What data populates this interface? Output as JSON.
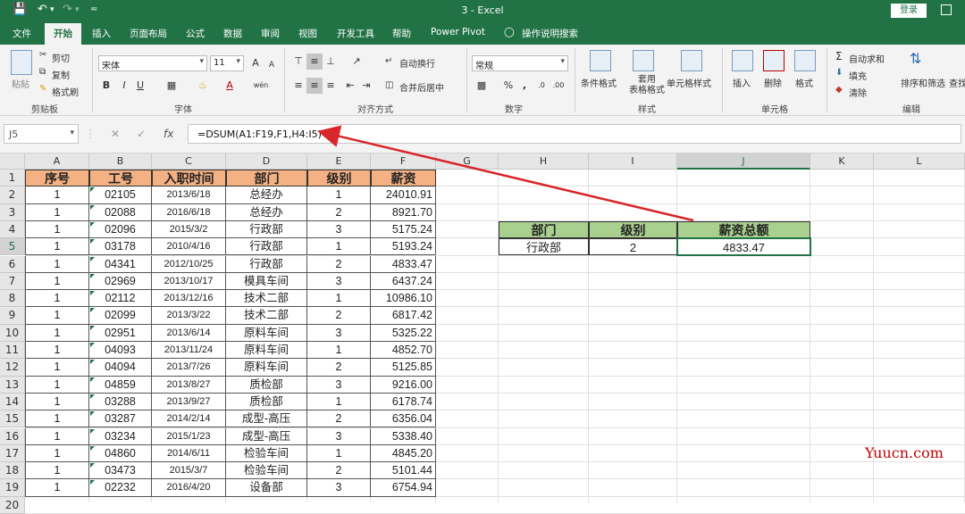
{
  "window": {
    "title": "3  -  Excel",
    "login_label": "登录"
  },
  "quick_access": {
    "save_icon": "save-icon",
    "undo_icon": "undo-icon",
    "redo_icon": "redo-icon"
  },
  "tabs": [
    {
      "label": "文件"
    },
    {
      "label": "开始",
      "active": true
    },
    {
      "label": "插入"
    },
    {
      "label": "页面布局"
    },
    {
      "label": "公式"
    },
    {
      "label": "数据"
    },
    {
      "label": "审阅"
    },
    {
      "label": "视图"
    },
    {
      "label": "开发工具"
    },
    {
      "label": "帮助"
    },
    {
      "label": "Power Pivot"
    },
    {
      "label": "操作说明搜索"
    }
  ],
  "ribbon": {
    "clipboard": {
      "paste": "粘贴",
      "cut": "剪切",
      "copy": "复制",
      "format_painter": "格式刷",
      "group": "剪贴板"
    },
    "font": {
      "name": "宋体",
      "size": "11",
      "grow": "A",
      "shrink": "A",
      "bold": "B",
      "italic": "I",
      "underline": "U",
      "wen": "wén",
      "group": "字体"
    },
    "alignment": {
      "wrap": "自动换行",
      "merge": "合并后居中",
      "group": "对齐方式"
    },
    "number": {
      "format": "常规",
      "percent": "%",
      "comma": ",",
      "group": "数字"
    },
    "styles": {
      "conditional": "条件格式",
      "table_format": "套用\n表格格式",
      "cell_styles": "单元格样式",
      "group": "样式"
    },
    "cells": {
      "insert": "插入",
      "delete": "删除",
      "format": "格式",
      "group": "单元格"
    },
    "editing": {
      "autosum": "自动求和",
      "fill": "填充",
      "clear": "清除",
      "sort": "排序和筛选",
      "find": "查找",
      "group": "编辑"
    }
  },
  "formula_bar": {
    "name_box": "J5",
    "cancel": "✕",
    "enter": "✓",
    "fx": "fx",
    "formula": "=DSUM(A1:F19,F1,H4:I5)"
  },
  "columns": [
    "A",
    "B",
    "C",
    "D",
    "E",
    "F",
    "G",
    "H",
    "I",
    "J",
    "K",
    "L"
  ],
  "rows": [
    "1",
    "2",
    "3",
    "4",
    "5",
    "6",
    "7",
    "8",
    "9",
    "10",
    "11",
    "12",
    "13",
    "14",
    "15",
    "16",
    "17",
    "18",
    "19",
    "20"
  ],
  "table": {
    "headers": [
      "序号",
      "工号",
      "入职时间",
      "部门",
      "级别",
      "薪资"
    ],
    "data": [
      [
        "1",
        "02105",
        "2013/6/18",
        "总经办",
        "1",
        "24010.91"
      ],
      [
        "1",
        "02088",
        "2016/6/18",
        "总经办",
        "2",
        "8921.70"
      ],
      [
        "1",
        "02096",
        "2015/3/2",
        "行政部",
        "3",
        "5175.24"
      ],
      [
        "1",
        "03178",
        "2010/4/16",
        "行政部",
        "1",
        "5193.24"
      ],
      [
        "1",
        "04341",
        "2012/10/25",
        "行政部",
        "2",
        "4833.47"
      ],
      [
        "1",
        "02969",
        "2013/10/17",
        "模具车间",
        "3",
        "6437.24"
      ],
      [
        "1",
        "02112",
        "2013/12/16",
        "技术二部",
        "1",
        "10986.10"
      ],
      [
        "1",
        "02099",
        "2013/3/22",
        "技术二部",
        "2",
        "6817.42"
      ],
      [
        "1",
        "02951",
        "2013/6/14",
        "原料车间",
        "3",
        "5325.22"
      ],
      [
        "1",
        "04093",
        "2013/11/24",
        "原料车间",
        "1",
        "4852.70"
      ],
      [
        "1",
        "04094",
        "2013/7/26",
        "原料车间",
        "2",
        "5125.85"
      ],
      [
        "1",
        "04859",
        "2013/8/27",
        "质检部",
        "3",
        "9216.00"
      ],
      [
        "1",
        "03288",
        "2013/9/27",
        "质检部",
        "1",
        "6178.74"
      ],
      [
        "1",
        "03287",
        "2014/2/14",
        "成型-高压",
        "2",
        "6356.04"
      ],
      [
        "1",
        "03234",
        "2015/1/23",
        "成型-高压",
        "3",
        "5338.40"
      ],
      [
        "1",
        "04860",
        "2014/6/11",
        "检验车间",
        "1",
        "4845.20"
      ],
      [
        "1",
        "03473",
        "2015/3/7",
        "检验车间",
        "2",
        "5101.44"
      ],
      [
        "1",
        "02232",
        "2016/4/20",
        "设备部",
        "3",
        "6754.94"
      ]
    ]
  },
  "criteria": {
    "headers": [
      "部门",
      "级别",
      "薪资总额"
    ],
    "values": [
      "行政部",
      "2",
      "4833.47"
    ]
  },
  "watermark": "Yuucn.com",
  "colors": {
    "excel_green": "#217346",
    "header_orange": "#f4b183",
    "criteria_green": "#a9d08e",
    "arrow_red": "#d9262a"
  }
}
